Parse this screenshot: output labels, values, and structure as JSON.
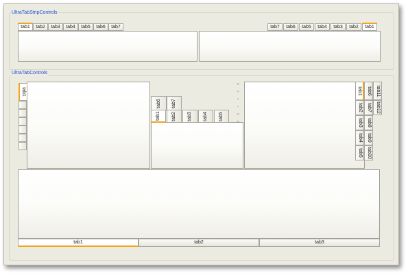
{
  "groups": {
    "tabstrip_title": "UltraTabStripControls",
    "tabcontrols_title": "UltraTabControls"
  },
  "strip_left_tabs": [
    "tab1",
    "tab2",
    "tab3",
    "tab4",
    "tab5",
    "tab6",
    "tab7"
  ],
  "strip_right_tabs": [
    "tab7",
    "tab6",
    "tab5",
    "tab4",
    "tab3",
    "tab2",
    "tab1"
  ],
  "left_vertical_tab": "tab1",
  "middle_top_tabs": [
    "tab6",
    "tab7"
  ],
  "middle_bottom_tabs": [
    "tab1",
    "tab2",
    "tab3",
    "tab4",
    "tab5"
  ],
  "scroll_buttons": [
    "«",
    "‹‹",
    "‹",
    "›",
    "››",
    "»"
  ],
  "right_tabs": {
    "col1": [
      "tab1",
      "tab2",
      "tab3",
      "tab4",
      "tab5"
    ],
    "col2": [
      "tab6",
      "tab7",
      "tab8",
      "tab9",
      "tab10"
    ],
    "col3": [
      "tab11",
      "tab12"
    ]
  },
  "bottom_tabs": [
    "tab1",
    "tab2",
    "tab3"
  ],
  "colors": {
    "accent": "#f0a51a",
    "group_title": "#1e4fd6",
    "background": "#ecebe1"
  }
}
